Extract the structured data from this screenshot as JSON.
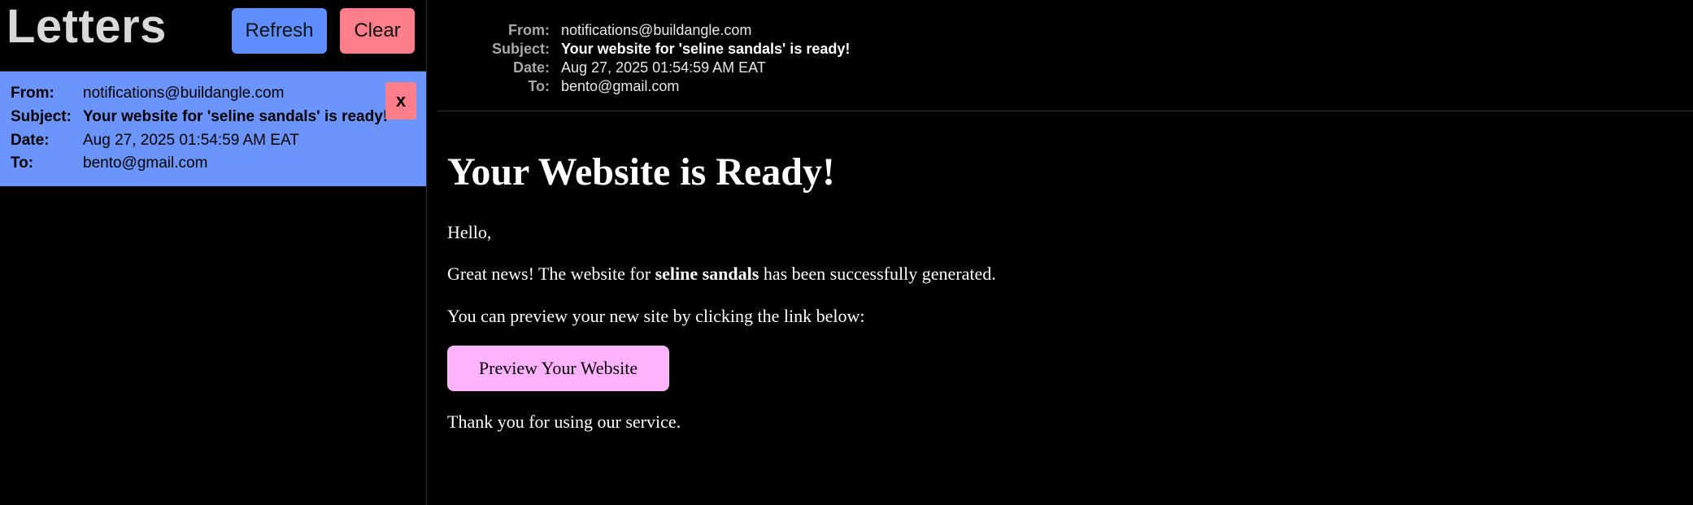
{
  "sidebar": {
    "title": "Letters",
    "refresh_label": "Refresh",
    "clear_label": "Clear",
    "messages": [
      {
        "from_label": "From:",
        "from": "notifications@buildangle.com",
        "subject_label": "Subject:",
        "subject": "Your website for 'seline sandals' is ready!",
        "date_label": "Date:",
        "date": "Aug 27, 2025 01:54:59 AM EAT",
        "to_label": "To:",
        "to": "bento@gmail.com",
        "delete_label": "x"
      }
    ]
  },
  "viewer": {
    "header": {
      "from_label": "From:",
      "from": "notifications@buildangle.com",
      "subject_label": "Subject:",
      "subject": "Your website for 'seline sandals' is ready!",
      "date_label": "Date:",
      "date": "Aug 27, 2025 01:54:59 AM EAT",
      "to_label": "To:",
      "to": "bento@gmail.com"
    },
    "body": {
      "heading": "Your Website is Ready!",
      "greeting": "Hello,",
      "news_prefix": "Great news! The website for ",
      "site_name": "seline sandals",
      "news_suffix": " has been successfully generated.",
      "preview_text": "You can preview your new site by clicking the link below:",
      "preview_button": "Preview Your Website",
      "thanks": "Thank you for using our service."
    }
  },
  "colors": {
    "background": "#000000",
    "refresh_button": "#5e8eff",
    "clear_button": "#ff7e8c",
    "selected_message": "#6b95fd",
    "preview_button": "#ffb3ff"
  }
}
